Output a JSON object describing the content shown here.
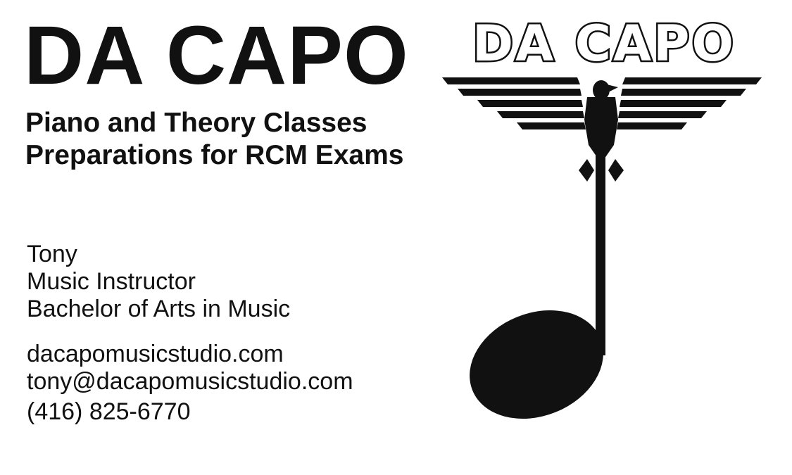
{
  "card": {
    "title": "DA CAPO",
    "services": [
      "Piano and Theory Classes",
      "Preparations for RCM Exams"
    ],
    "person": {
      "name": "Tony",
      "role": "Music Instructor",
      "degree": "Bachelor of Arts in Music"
    },
    "contact": {
      "website": "dacapomusicstudio.com",
      "email": "tony@dacapomusicstudio.com",
      "phone": "(416) 825-6770"
    }
  },
  "logo": {
    "wordmark": "DA CAPO",
    "icon": "eagle-music-note-icon",
    "color": "#111111"
  }
}
